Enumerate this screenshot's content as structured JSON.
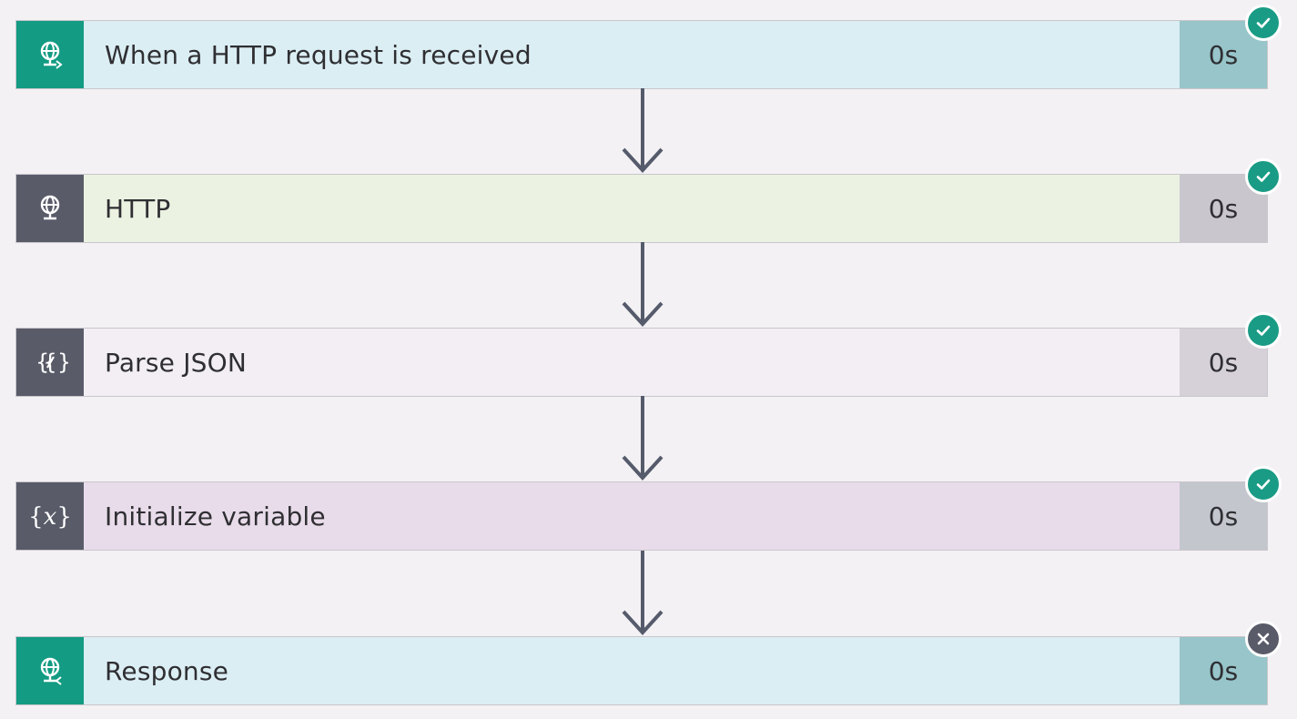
{
  "colors": {
    "background": "#f3f1f4",
    "connector": "#555b6b",
    "status_success": "#1a9b85",
    "status_failed": "#595b69"
  },
  "steps": [
    {
      "title": "When a HTTP request is received",
      "duration": "0s",
      "icon": "http-request-globe-icon",
      "status": "succeeded",
      "icon_bg": "#139b83",
      "body_bg": "#dbeef3",
      "duration_bg": "#97c5c9"
    },
    {
      "title": "HTTP",
      "duration": "0s",
      "icon": "http-globe-icon",
      "status": "succeeded",
      "icon_bg": "#595b69",
      "body_bg": "#ebf2e2",
      "duration_bg": "#c9c7cd"
    },
    {
      "title": "Parse JSON",
      "duration": "0s",
      "icon": "parse-json-icon",
      "status": "succeeded",
      "icon_bg": "#595b69",
      "body_bg": "#f2eef4",
      "duration_bg": "#d6d1d8"
    },
    {
      "title": "Initialize variable",
      "duration": "0s",
      "icon": "variable-icon",
      "status": "succeeded",
      "icon_bg": "#595b69",
      "body_bg": "#e9dcea",
      "duration_bg": "#c3c6cd"
    },
    {
      "title": "Response",
      "duration": "0s",
      "icon": "response-globe-icon",
      "status": "failed",
      "icon_bg": "#139b83",
      "body_bg": "#dbeef3",
      "duration_bg": "#97c5c9"
    }
  ]
}
